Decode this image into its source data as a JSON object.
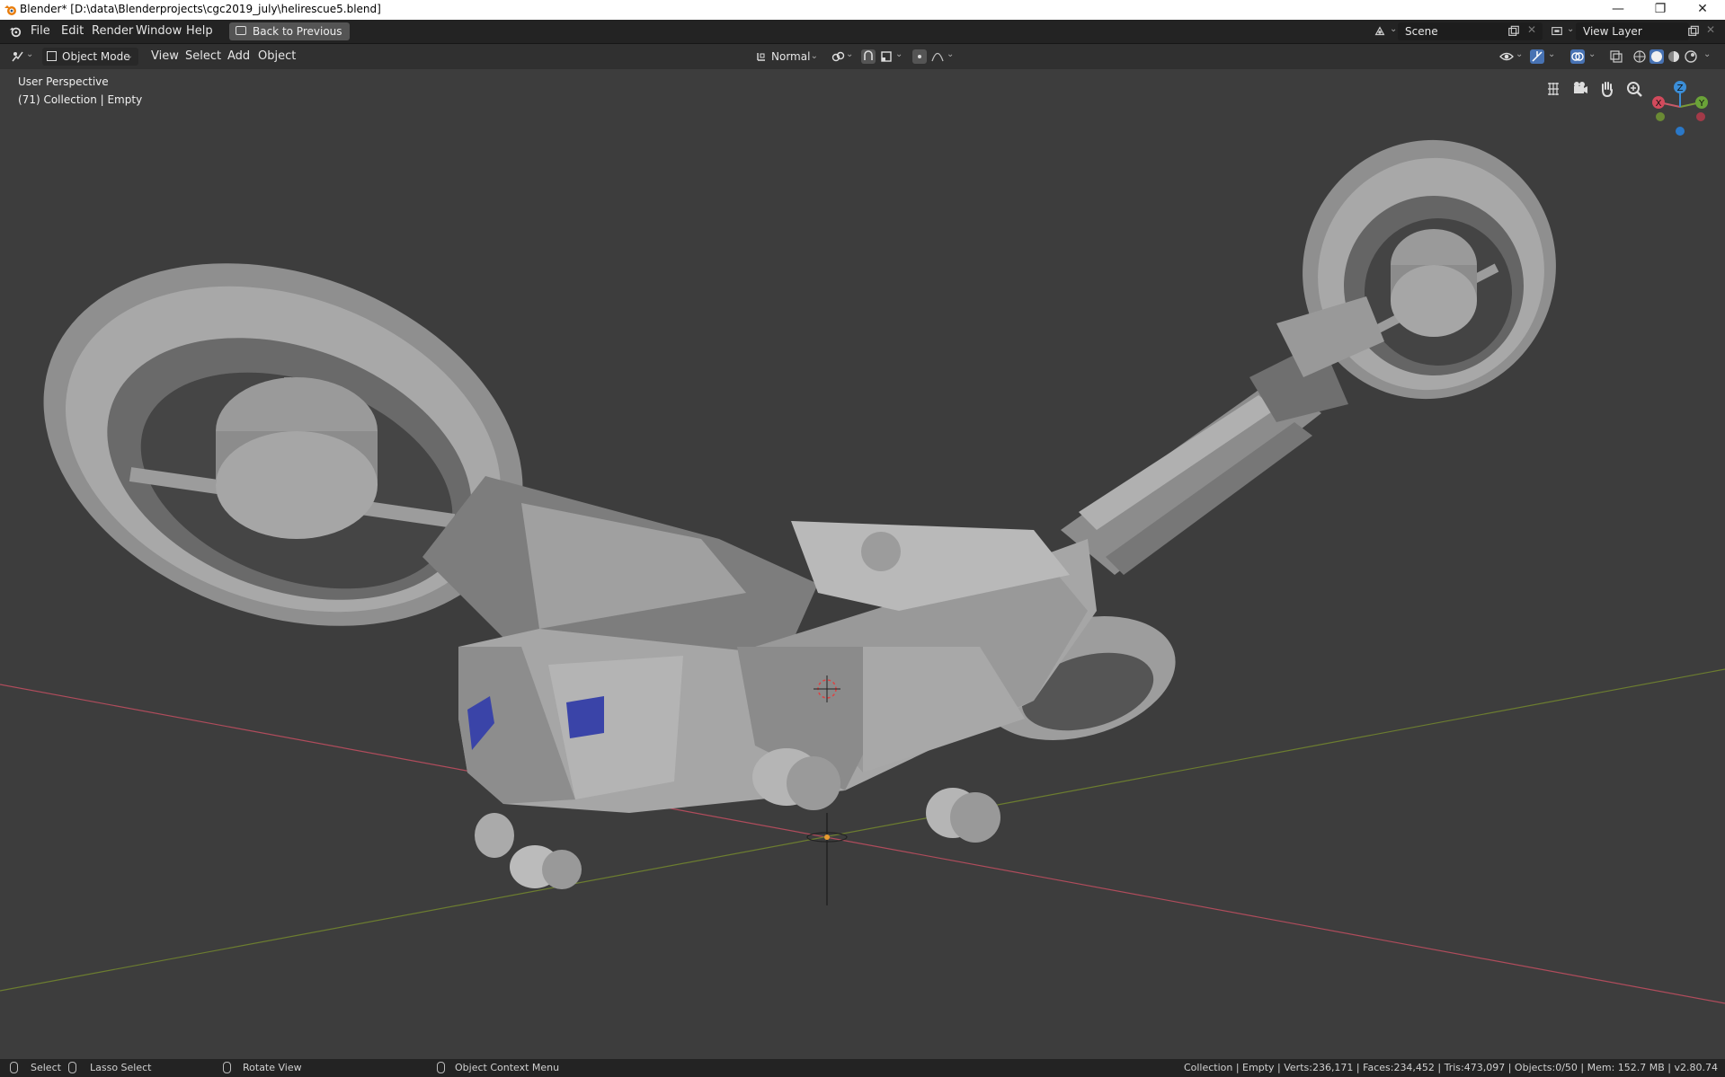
{
  "window": {
    "title": "Blender* [D:\\data\\Blenderprojects\\cgc2019_july\\helirescue5.blend]",
    "minimize_glyph": "—",
    "restore_glyph": "❐",
    "close_glyph": "✕"
  },
  "menubar": {
    "items": [
      "File",
      "Edit",
      "Render",
      "Window",
      "Help"
    ],
    "back_button": "Back to Previous",
    "scene": "Scene",
    "view_layer": "View Layer"
  },
  "viewheader": {
    "mode": "Object Mode",
    "menus": [
      "View",
      "Select",
      "Add",
      "Object"
    ],
    "orientation": "Normal"
  },
  "viewport": {
    "perspective_label": "User Perspective",
    "collection_label": "(71) Collection | Empty",
    "gizmo_axes": {
      "x": "X",
      "y": "Y",
      "z": "Z"
    },
    "colors": {
      "background": "#3d3d3d",
      "x_axis": "#c75a68",
      "y_axis": "#7a8c3c",
      "model": "#a3a3a3",
      "decal": "#3a44a8"
    },
    "icons": [
      "grid-toggle-icon",
      "camera-view-icon",
      "pan-hand-icon",
      "zoom-icon"
    ]
  },
  "statusbar": {
    "select": "Select",
    "lasso": "Lasso Select",
    "rotate": "Rotate View",
    "context": "Object Context Menu",
    "stats": "Collection | Empty | Verts:236,171 | Faces:234,452 | Tris:473,097 | Objects:0/50 | Mem: 152.7 MB | v2.80.74"
  }
}
